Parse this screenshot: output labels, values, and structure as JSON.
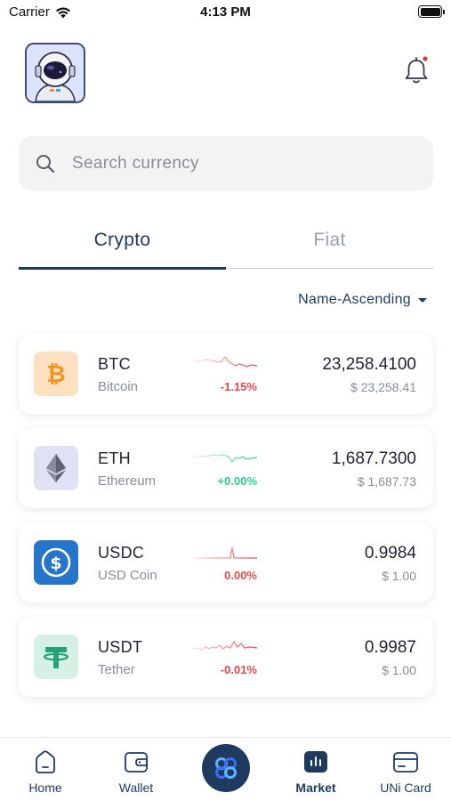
{
  "status_bar": {
    "carrier": "Carrier",
    "time": "4:13 PM"
  },
  "header": {
    "avatar": "astronaut-avatar",
    "notification_icon": "bell-icon",
    "notification_dot_color": "#e53935"
  },
  "search": {
    "placeholder": "Search currency",
    "icon": "search-icon"
  },
  "tabs": [
    {
      "label": "Crypto",
      "active": true
    },
    {
      "label": "Fiat",
      "active": false
    }
  ],
  "sort": {
    "label": "Name-Ascending",
    "icon": "caret-down-icon"
  },
  "coins": [
    {
      "symbol": "BTC",
      "name": "Bitcoin",
      "change": "-1.15%",
      "change_color": "#e5484d",
      "price": "23,258.4100",
      "fiat": "$ 23,258.41",
      "icon": "bitcoin-icon",
      "accent": "#f7931a"
    },
    {
      "symbol": "ETH",
      "name": "Ethereum",
      "change": "+0.00%",
      "change_color": "#2ecc8f",
      "price": "1,687.7300",
      "fiat": "$ 1,687.73",
      "icon": "ethereum-icon",
      "accent": "#627eea"
    },
    {
      "symbol": "USDC",
      "name": "USD Coin",
      "change": "0.00%",
      "change_color": "#e5484d",
      "price": "0.9984",
      "fiat": "$ 1.00",
      "icon": "usdc-icon",
      "accent": "#2775ca"
    },
    {
      "symbol": "USDT",
      "name": "Tether",
      "change": "-0.01%",
      "change_color": "#e5484d",
      "price": "0.9987",
      "fiat": "$ 1.00",
      "icon": "tether-icon",
      "accent": "#26a17b"
    }
  ],
  "bottom_nav": [
    {
      "label": "Home",
      "icon": "home-icon",
      "active": false
    },
    {
      "label": "Wallet",
      "icon": "wallet-icon",
      "active": false
    },
    {
      "label": "",
      "icon": "app-logo-icon",
      "active": false
    },
    {
      "label": "Market",
      "icon": "market-chart-icon",
      "active": true
    },
    {
      "label": "UNi Card",
      "icon": "card-icon",
      "active": false
    }
  ],
  "colors": {
    "primary": "#1e3a5f",
    "muted": "#8a8d96",
    "negative": "#e5484d",
    "positive": "#2ecc8f"
  }
}
